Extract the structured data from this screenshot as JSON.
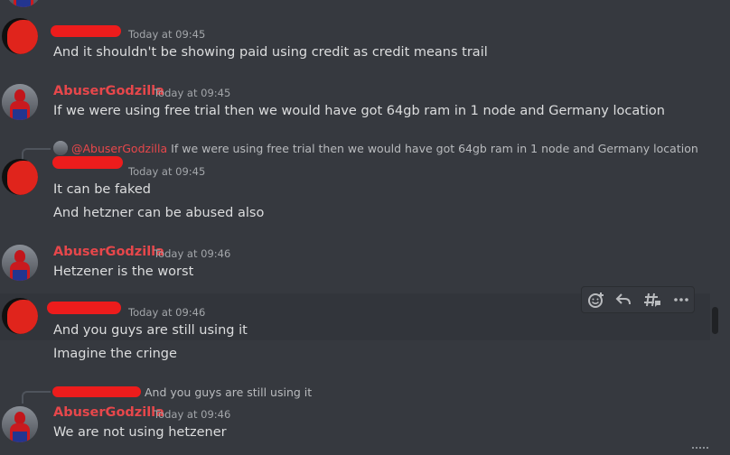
{
  "messages": [
    {
      "author": "",
      "author_redacted": true,
      "timestamp": "Today at 09:45",
      "lines": [
        "And it shouldn't be showing paid using credit as credit means trail"
      ],
      "avatar": "red-blot-avatar"
    },
    {
      "author": "AbuserGodzilla",
      "timestamp": "Today at 09:45",
      "lines": [
        "If we were using free trial then we would have got 64gb ram in 1 node and Germany location"
      ],
      "avatar": "spiderman-avatar"
    },
    {
      "reply_to": {
        "author": "@AbuserGodzilla",
        "text": "If we were using free trial then we would have got 64gb ram in 1 node and Germany location"
      },
      "author": "",
      "author_redacted": true,
      "timestamp": "Today at 09:45",
      "lines": [
        "It can be faked",
        "And hetzner can be abused also"
      ],
      "avatar": "red-blot-avatar"
    },
    {
      "author": "AbuserGodzilla",
      "timestamp": "Today at 09:46",
      "lines": [
        "Hetzener is the worst"
      ],
      "avatar": "spiderman-avatar"
    },
    {
      "author": "",
      "author_redacted": true,
      "timestamp": "Today at 09:46",
      "lines": [
        "And you guys are still using it",
        "Imagine the cringe"
      ],
      "avatar": "red-blot-avatar",
      "hovered": true
    },
    {
      "reply_to": {
        "author": "",
        "author_redacted": true,
        "text": "And you guys are still using it"
      },
      "author": "AbuserGodzilla",
      "timestamp": "Today at 09:46",
      "lines": [
        "We are not using hetzener"
      ],
      "avatar": "spiderman-avatar"
    }
  ],
  "toolbar": {
    "buttons": [
      "add-reaction-icon",
      "reply-icon",
      "create-thread-icon",
      "more-icon"
    ]
  },
  "colors": {
    "background": "#36393f",
    "username_red": "#e7474b",
    "text": "#dcddde",
    "timestamp": "#a3a6aa",
    "redaction": "#ed1c1c"
  }
}
